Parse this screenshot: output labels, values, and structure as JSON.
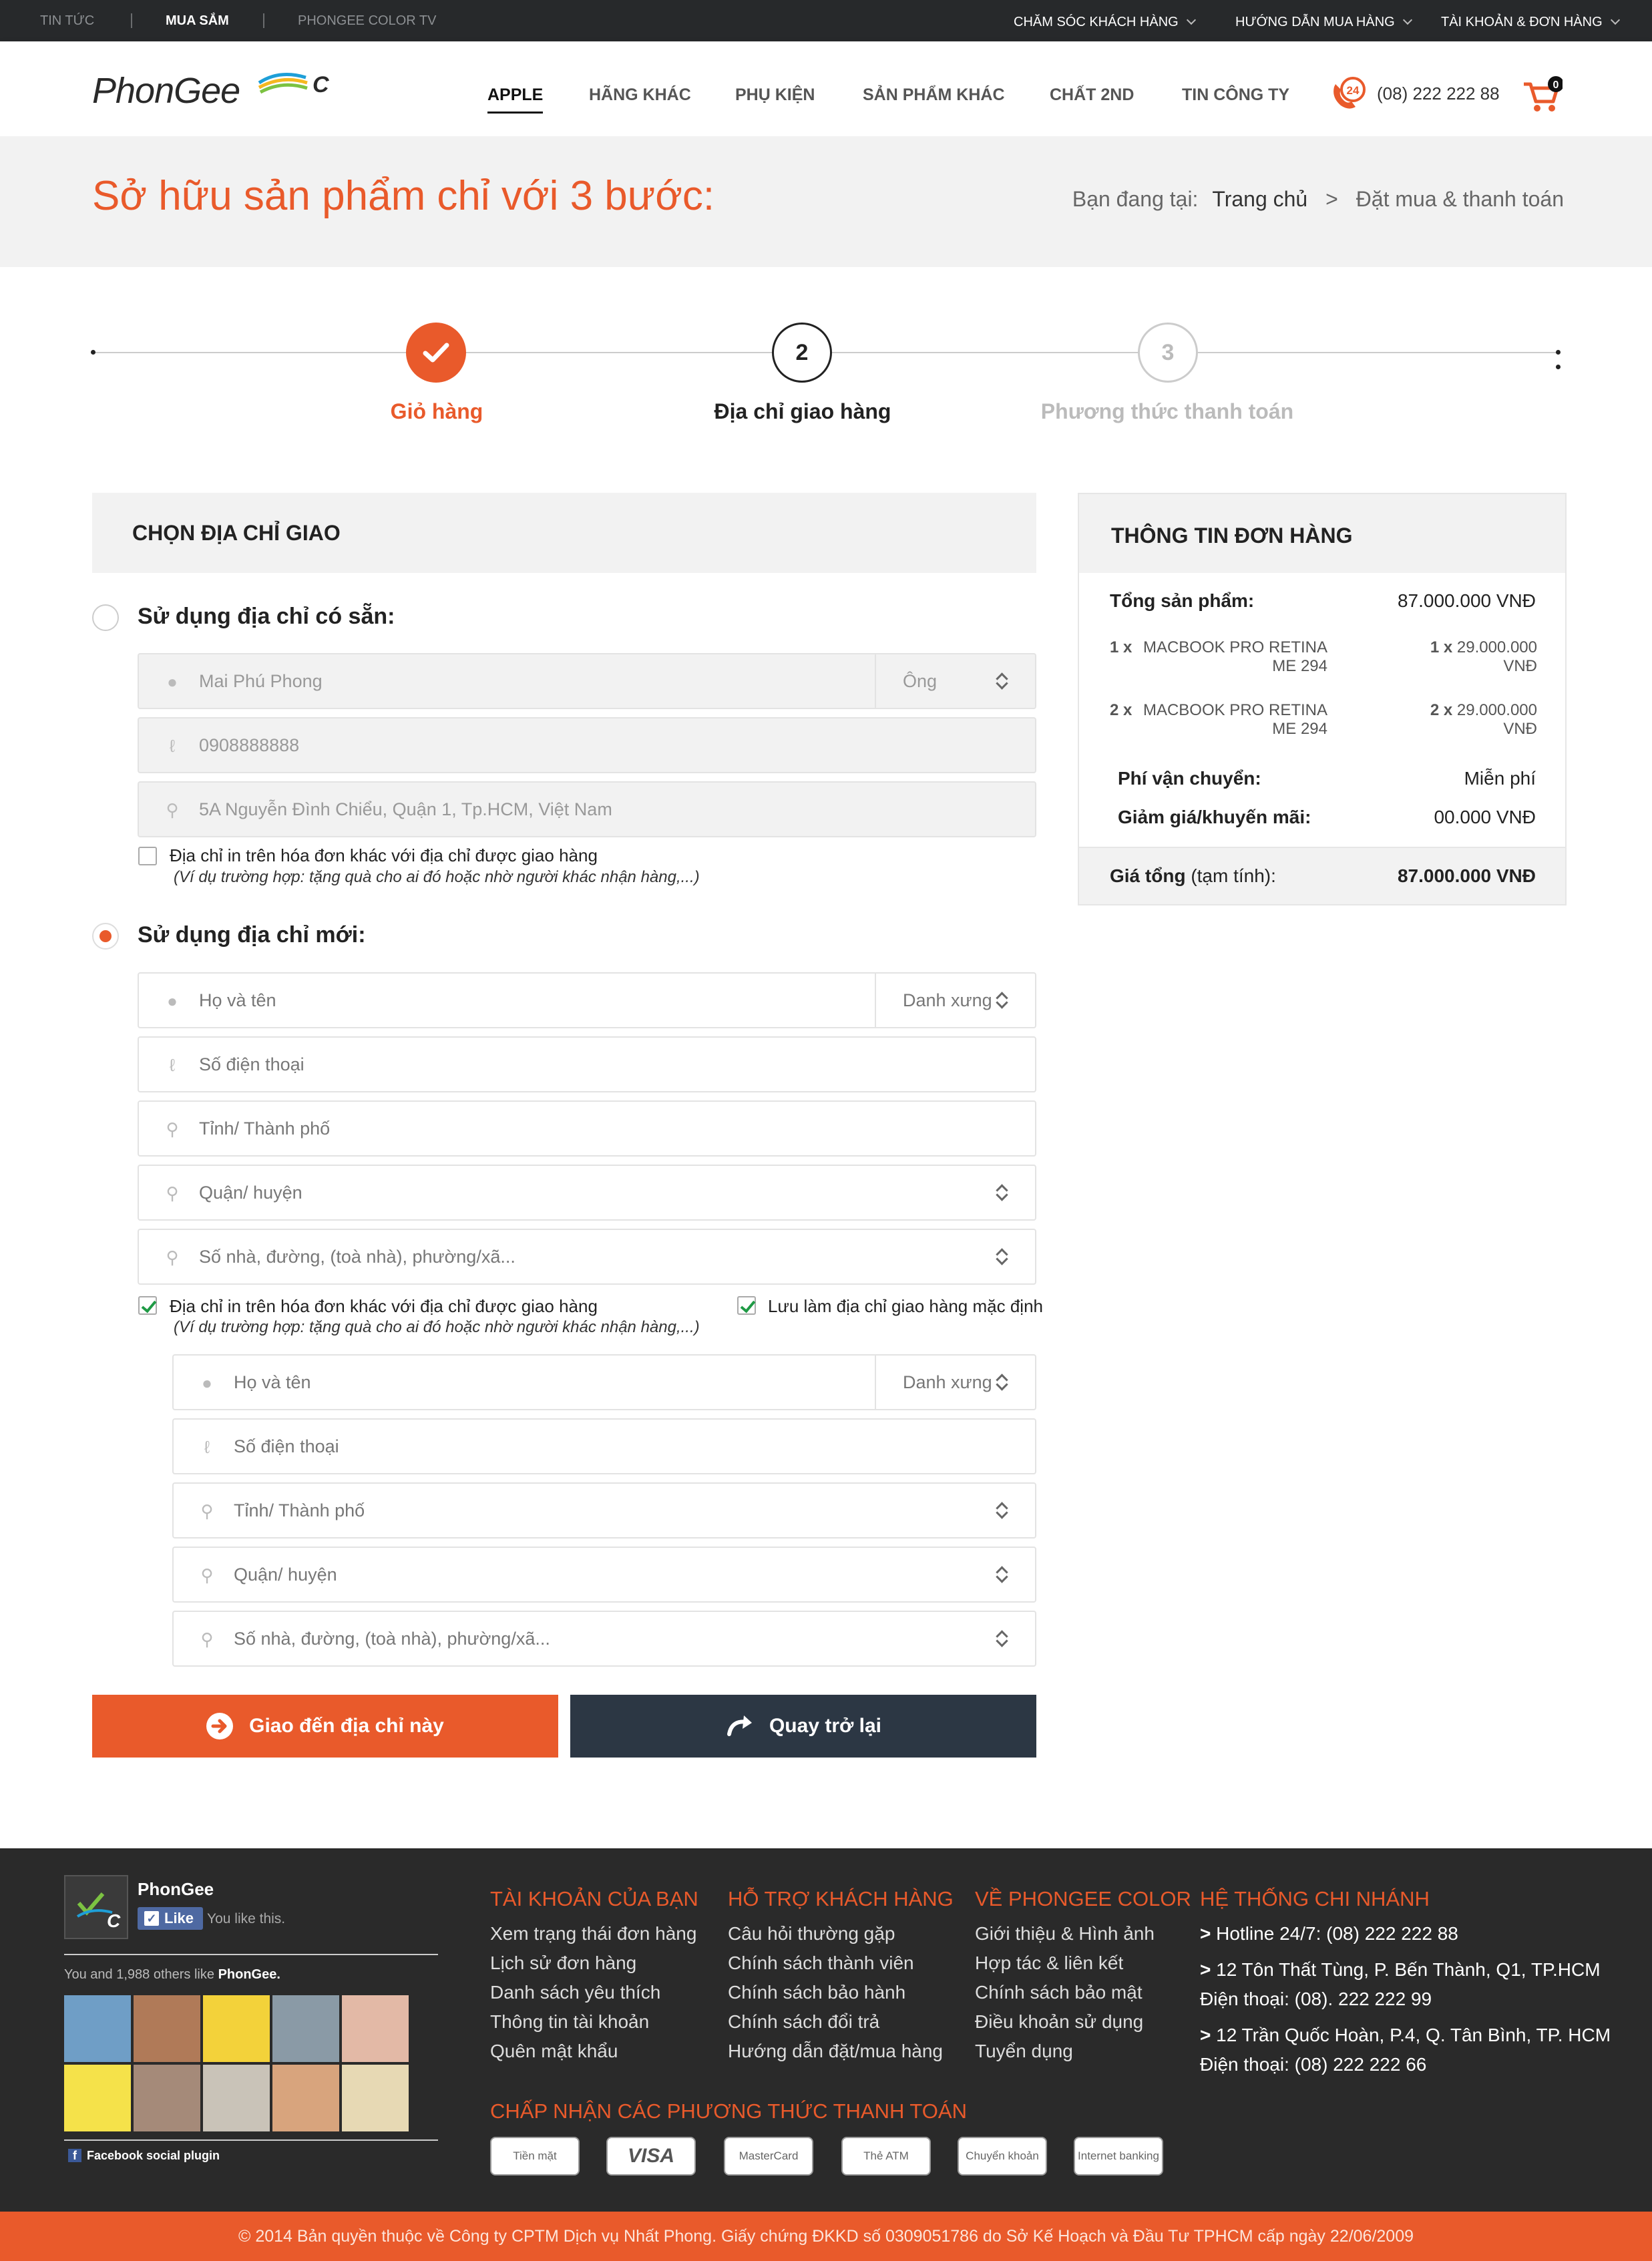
{
  "topbar": {
    "left": [
      "TIN TỨC",
      "MUA SẮM",
      "PHONGEE COLOR TV"
    ],
    "right": [
      "CHĂM SÓC KHÁCH HÀNG",
      "HƯỚNG DẪN MUA HÀNG",
      "TÀI KHOẢN & ĐƠN HÀNG"
    ]
  },
  "header": {
    "logo_text": "PhonGee",
    "nav": [
      "APPLE",
      "HÃNG KHÁC",
      "PHỤ KIỆN",
      "SẢN PHẨM KHÁC",
      "CHẤT 2ND",
      "TIN CÔNG TY"
    ],
    "hotline_badge": "24",
    "hotline": "(08) 222 222 88",
    "cart_count": "0"
  },
  "hero": {
    "title": "Sở hữu sản phẩm chỉ với 3 bước:",
    "crumb_prefix": "Bạn đang tại:",
    "crumb_home": "Trang chủ",
    "crumb_sep": ">",
    "crumb_current": "Đặt mua & thanh toán"
  },
  "steps": [
    {
      "num": "",
      "label": "Giỏ hàng",
      "state": "done"
    },
    {
      "num": "2",
      "label": "Địa chỉ giao hàng",
      "state": "active"
    },
    {
      "num": "3",
      "label": "Phương thức thanh toán",
      "state": "todo"
    }
  ],
  "address": {
    "panel_title": "CHỌN ĐỊA CHỈ GIAO",
    "existing": {
      "label": "Sử dụng địa chỉ có sẵn:",
      "name": "Mai Phú Phong",
      "title": "Ông",
      "phone": "0908888888",
      "address": "5A Nguyễn Đình Chiểu, Quận 1, Tp.HCM, Việt Nam",
      "checkbox_label": "Địa chỉ in trên hóa đơn khác với địa chỉ được giao hàng",
      "checkbox_note": "(Ví dụ trường hợp: tặng quà cho ai đó hoặc nhờ người khác nhận hàng,...)"
    },
    "new": {
      "label": "Sử dụng địa chỉ mới:",
      "name_ph": "Họ và tên",
      "title_ph": "Danh xưng",
      "phone_ph": "Số điện thoại",
      "city_ph": "Tỉnh/ Thành phố",
      "district_ph": "Quận/ huyện",
      "street_ph": "Số nhà, đường, (toà nhà), phường/xã...",
      "checkbox_label": "Địa chỉ in trên hóa đơn khác với địa chỉ được giao hàng",
      "checkbox_note": "(Ví dụ trường hợp: tặng quà cho ai đó hoặc nhờ người khác nhận hàng,...)",
      "save_default": "Lưu làm địa chỉ giao hàng mặc định"
    },
    "submit": "Giao đến địa chỉ này",
    "back": "Quay trở lại"
  },
  "order": {
    "title": "THÔNG TIN ĐƠN HÀNG",
    "total_label": "Tổng sản phẩm:",
    "total_value": "87.000.000 VNĐ",
    "items": [
      {
        "qty": "1 x",
        "name1": "MACBOOK PRO RETINA",
        "name2": "ME 294",
        "pq": "1 x",
        "price1": "29.000.000",
        "price2": "VNĐ"
      },
      {
        "qty": "2 x",
        "name1": "MACBOOK PRO RETINA",
        "name2": "ME 294",
        "pq": "2 x",
        "price1": "29.000.000",
        "price2": "VNĐ"
      }
    ],
    "shipping_label": "Phí vận chuyển:",
    "shipping_value": "Miễn phí",
    "discount_label": "Giảm giá/khuyến mãi:",
    "discount_value": "00.000 VNĐ",
    "grand_label": "Giá tổng",
    "grand_note": "(tạm tính):",
    "grand_value": "87.000.000 VNĐ"
  },
  "footer": {
    "fb": {
      "page": "PhonGee",
      "like": "Like",
      "you_like": "You like this.",
      "others": "You and 1,988 others like",
      "others_page": "PhonGee.",
      "plugin": "Facebook social plugin"
    },
    "cols": [
      {
        "title": "TÀI KHOẢN CỦA BẠN",
        "items": [
          "Xem trạng thái đơn hàng",
          "Lịch sử đơn hàng",
          "Danh sách yêu thích",
          "Thông tin tài khoản",
          "Quên mật khẩu"
        ]
      },
      {
        "title": "HỖ TRỢ KHÁCH HÀNG",
        "items": [
          "Câu hỏi thường gặp",
          "Chính sách thành viên",
          "Chính sách bảo hành",
          "Chính sách đổi trả",
          "Hướng dẫn đặt/mua hàng"
        ]
      },
      {
        "title": "VỀ PHONGEE COLOR",
        "items": [
          "Giới thiệu & Hình ảnh",
          "Hợp tác & liên kết",
          "Chính sách bảo mật",
          "Điều khoản sử dụng",
          "Tuyển dụng"
        ]
      }
    ],
    "branches": {
      "title": "HỆ THỐNG CHI NHÁNH",
      "hotline": "Hotline 24/7:  (08) 222 222 88",
      "b1": "12 Tôn Thất Tùng, P. Bến Thành, Q1, TP.HCM",
      "b1_phone": "Điện thoại: (08). 222 222 99",
      "b2": "12 Trần Quốc Hoàn, P.4, Q. Tân Bình, TP. HCM",
      "b2_phone": "Điện thoại: (08) 222 222 66"
    },
    "pay_title": "CHẤP NHẬN CÁC PHƯƠNG THỨC THANH TOÁN",
    "pay": [
      "Tiền mặt",
      "VISA",
      "MasterCard",
      "Thẻ ATM",
      "Chuyển khoản",
      "Internet banking"
    ],
    "copyright": "© 2014 Bản quyền thuộc về Công ty CPTM Dịch vụ Nhất Phong. Giấy chứng ĐKKD số 0309051786 do Sở Kế Hoạch và Đầu Tư TPHCM cấp ngày 22/06/2009"
  },
  "colors": {
    "accent": "#e95a2b",
    "dark": "#27292b",
    "button_dark": "#2c3744",
    "check": "#1f9a45"
  }
}
